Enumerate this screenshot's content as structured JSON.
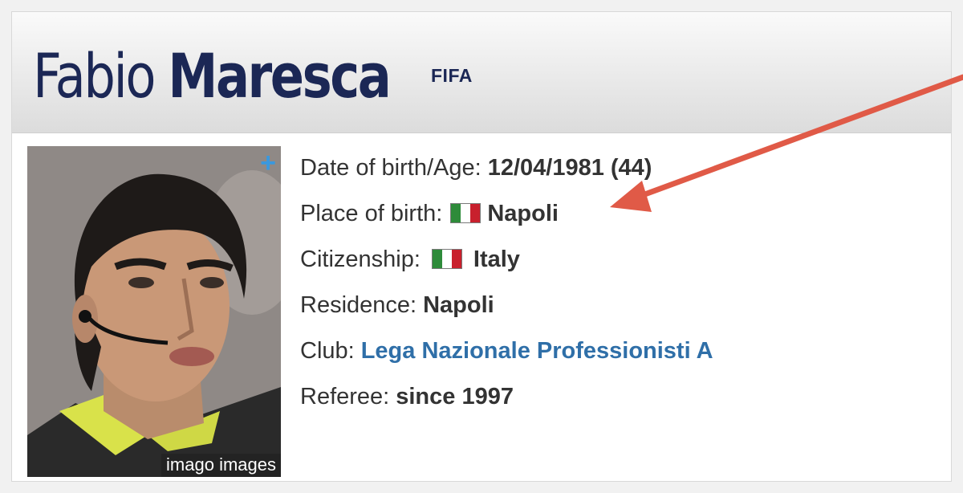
{
  "header": {
    "first_name": "Fabio",
    "last_name": "Maresca",
    "badge": "FIFA"
  },
  "photo": {
    "credit": "imago images",
    "expand_symbol": "+"
  },
  "details": {
    "dob_label": "Date of birth/Age:",
    "dob_value": "12/04/1981 (44)",
    "pob_label": "Place of birth:",
    "pob_value": "Napoli",
    "citizenship_label": "Citizenship:",
    "citizenship_value": "Italy",
    "residence_label": "Residence:",
    "residence_value": "Napoli",
    "club_label": "Club:",
    "club_value": "Lega Nazionale Professionisti A",
    "referee_label": "Referee:",
    "referee_value": "since 1997"
  },
  "icons": {
    "flag": "italy-flag-icon",
    "annotation": "red-arrow"
  },
  "colors": {
    "name": "#1b2755",
    "link": "#2f6fa8",
    "plus": "#3a98de",
    "arrow": "#e05a47",
    "flag_green": "#2e8b3a",
    "flag_white": "#ffffff",
    "flag_red": "#c8202d"
  }
}
